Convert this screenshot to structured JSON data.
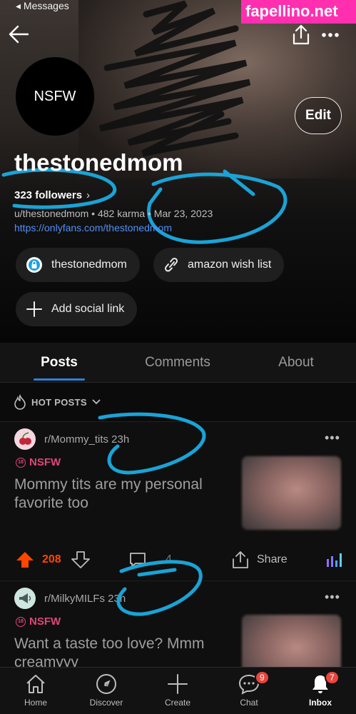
{
  "status_bar": {
    "back_label": "Messages"
  },
  "watermark": "fapellino.net",
  "header": {
    "back_icon": "arrow-left-icon",
    "share_icon": "share-icon",
    "more_icon": "more-horizontal-icon"
  },
  "profile": {
    "avatar_text": "NSFW",
    "edit_label": "Edit",
    "username": "thestonedmom",
    "followers": "323 followers",
    "meta": "u/thestonedmom • 482 karma • Mar 23, 2023",
    "link": "https://onlyfans.com/thestonedmom",
    "social_links": [
      {
        "label": "thestonedmom",
        "icon": "onlyfans-lock-icon"
      },
      {
        "label": "amazon wish list",
        "icon": "link-icon"
      },
      {
        "label": "Add social link",
        "icon": "plus-icon"
      }
    ]
  },
  "tabs": [
    {
      "label": "Posts",
      "active": true
    },
    {
      "label": "Comments",
      "active": false
    },
    {
      "label": "About",
      "active": false
    }
  ],
  "sort": {
    "label": "HOT POSTS",
    "icon": "flame-icon"
  },
  "posts": [
    {
      "subreddit": "r/Mommy_tits",
      "age": "23h",
      "nsfw": "NSFW",
      "title": "Mommy tits are my personal favorite too",
      "votes": "208",
      "comments": "4",
      "share": "Share"
    },
    {
      "subreddit": "r/MilkyMILFs",
      "age": "23h",
      "nsfw": "NSFW",
      "title": "Want a taste too love? Mmm creamyyy"
    }
  ],
  "bottom_nav": [
    {
      "label": "Home",
      "icon": "home-icon"
    },
    {
      "label": "Discover",
      "icon": "compass-icon"
    },
    {
      "label": "Create",
      "icon": "plus-icon"
    },
    {
      "label": "Chat",
      "icon": "chat-icon",
      "badge": "9"
    },
    {
      "label": "Inbox",
      "icon": "bell-icon",
      "badge": "7",
      "active": true
    }
  ],
  "colors": {
    "accent_blue": "#2f7fd6",
    "upvote_orange": "#ff4500",
    "nsfw_pink": "#e0457b",
    "badge_red": "#e8453c",
    "watermark_pink": "#ff2fb0"
  }
}
